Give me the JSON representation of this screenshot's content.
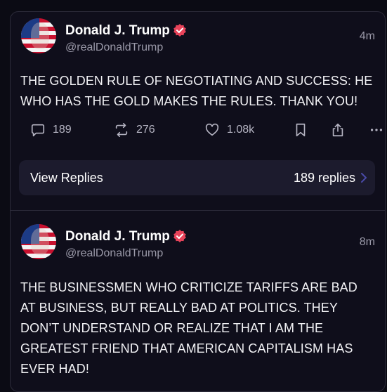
{
  "posts": [
    {
      "author": "Donald J. Trump",
      "handle": "@realDonaldTrump",
      "time": "4m",
      "text": "THE GOLDEN RULE OF NEGOTIATING AND SUCCESS: HE WHO HAS THE GOLD MAKES THE RULES. THANK YOU!",
      "replies_count": "189",
      "reposts_count": "276",
      "likes_count": "1.08k",
      "view_replies_label": "View Replies",
      "replies_label": "189 replies"
    },
    {
      "author": "Donald J. Trump",
      "handle": "@realDonaldTrump",
      "time": "8m",
      "text": "THE BUSINESSMEN WHO CRITICIZE TARIFFS ARE BAD AT BUSINESS, BUT REALLY BAD AT POLITICS. THEY DON’T UNDERSTAND OR REALIZE THAT I AM THE GREATEST FRIEND THAT AMERICAN CAPITALISM HAS EVER HAD!"
    }
  ],
  "icons": {
    "verified": "verified-badge-icon",
    "reply": "reply-icon",
    "repost": "repost-icon",
    "like": "heart-icon",
    "bookmark": "bookmark-icon",
    "share": "share-icon",
    "more": "more-icon",
    "chevron": "chevron-right-icon"
  },
  "colors": {
    "background": "#0f0e1b",
    "text": "#f2f2f5",
    "muted": "#9a99a8",
    "badge": "#e8435a",
    "replies_bg": "#1c1b2d",
    "chevron": "#4a4aa8"
  }
}
